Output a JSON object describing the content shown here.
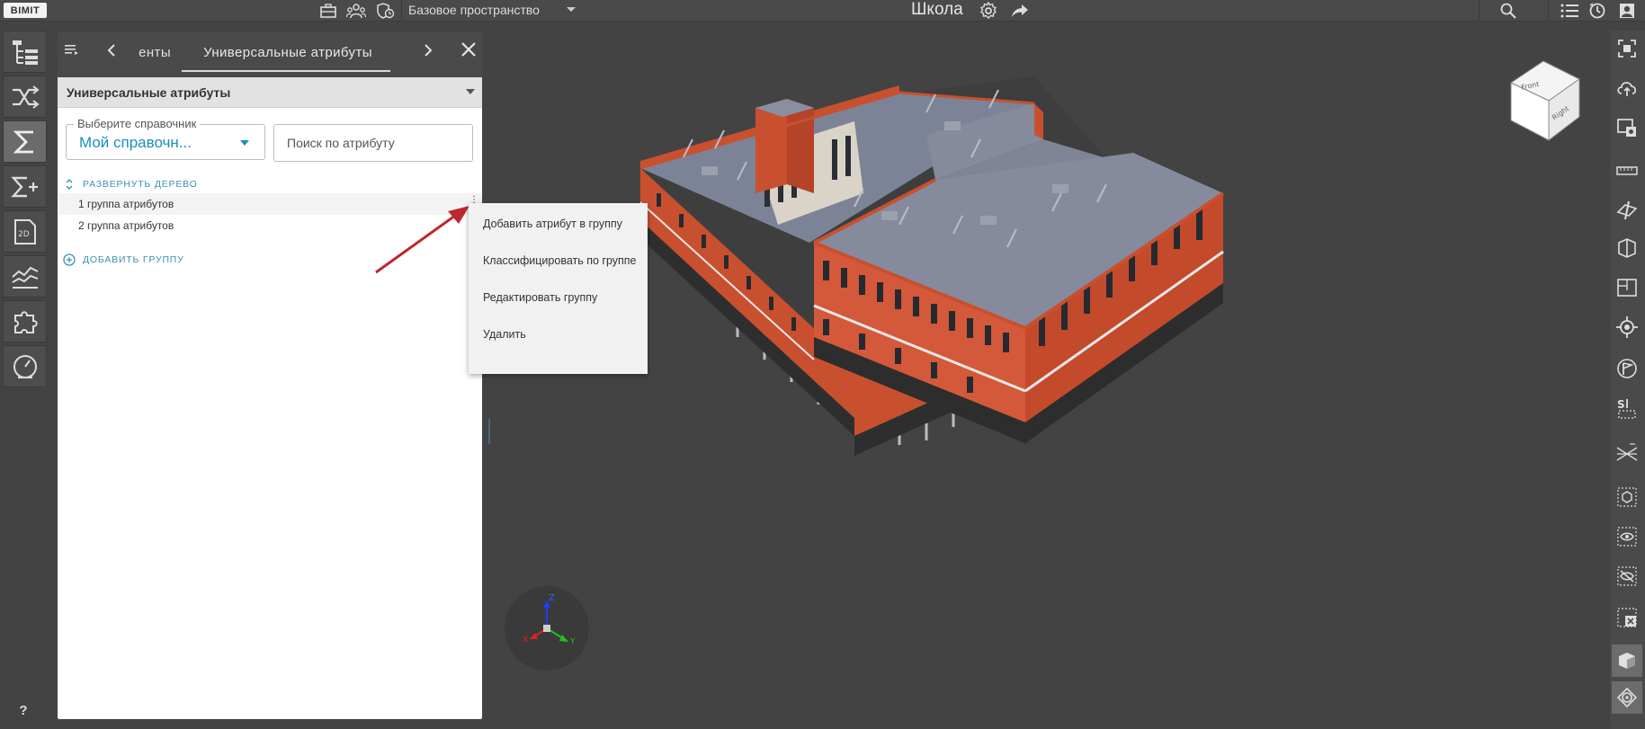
{
  "app": {
    "logo": "BIMIT",
    "workspace": "Базовое пространство",
    "project_title": "Школа"
  },
  "panel": {
    "tab_prev_label": "Элементы",
    "tab_active_label": "Универсальные атрибуты",
    "section_title": "Универсальные атрибуты",
    "select_legend": "Выберите справочник",
    "select_value": "Мой справочн...",
    "search_placeholder": "Поиск по атрибуту",
    "expand_tree_label": "РАЗВЕРНУТЬ ДЕРЕВО",
    "groups": [
      "1 группа атрибутов",
      "2 группа атрибутов"
    ],
    "add_group_label": "ДОБАВИТЬ ГРУППУ"
  },
  "context_menu": {
    "items": [
      "Добавить атрибут в группу",
      "Классифицировать по группе",
      "Редактировать группу",
      "Удалить"
    ]
  },
  "viewcube": {
    "front": "Front",
    "right": "Right"
  },
  "axes": {
    "x": "X",
    "y": "Y",
    "z": "Z"
  },
  "help_label": "?",
  "colors": {
    "accent": "#1a8fbf",
    "toolbar": "#4a4a4a",
    "viewport": "#434343",
    "arrow": "#c0262d"
  }
}
